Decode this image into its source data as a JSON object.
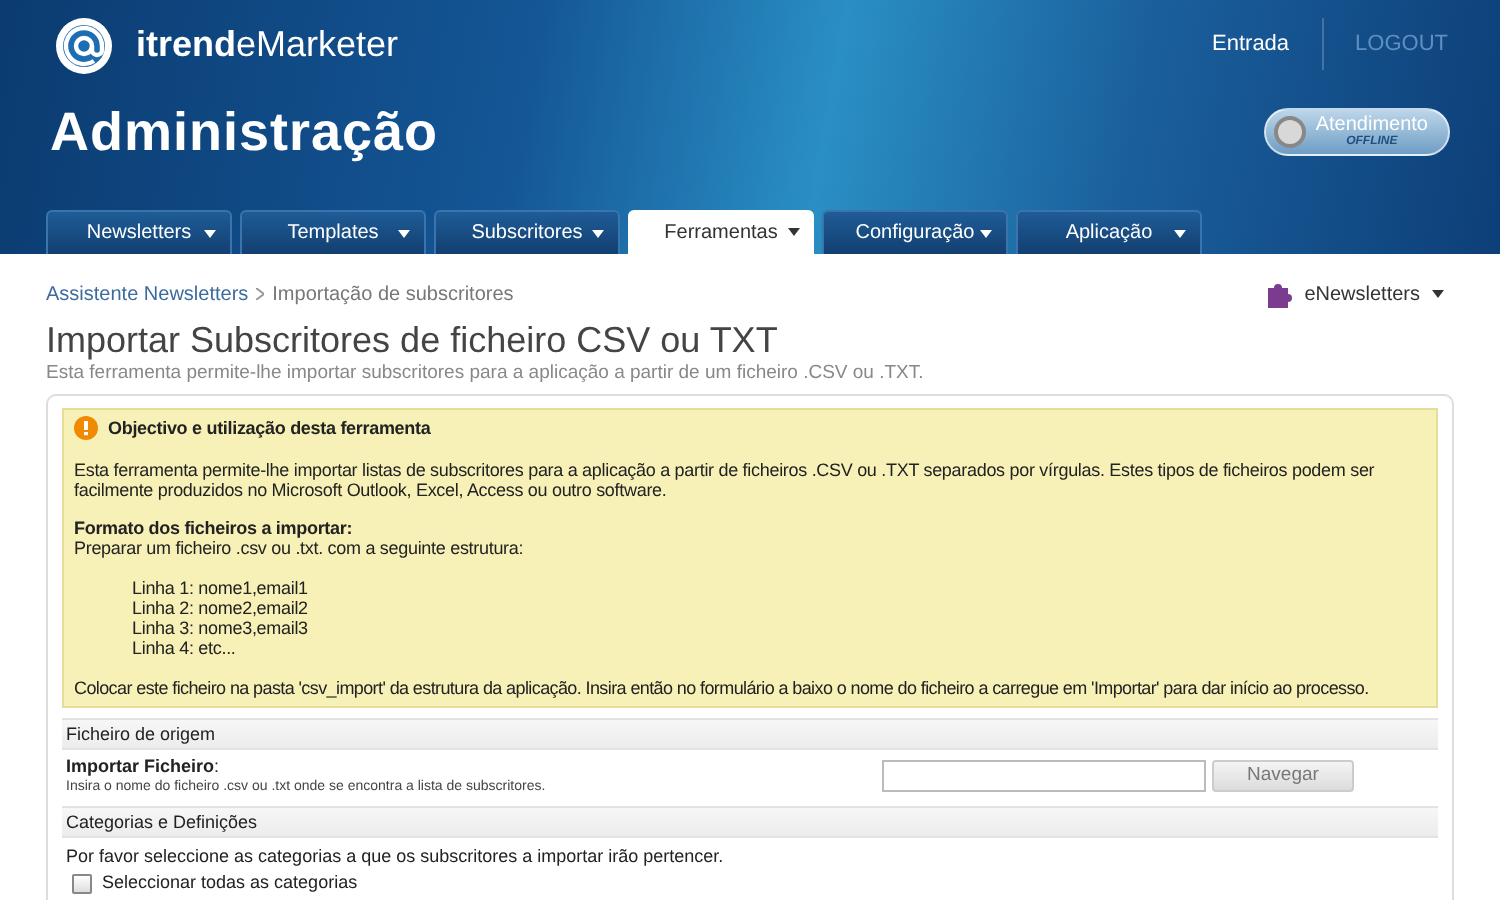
{
  "header": {
    "brand": {
      "bold": "itrend",
      "rest": "eMarketer"
    },
    "links": [
      {
        "label": "Entrada",
        "muted": false
      },
      {
        "label": "LOGOUT",
        "muted": true
      }
    ],
    "title": "Administração",
    "chat": {
      "label": "Atendimento",
      "status": "OFFLINE"
    }
  },
  "tabs": [
    {
      "label": "Newsletters",
      "selected": false
    },
    {
      "label": "Templates",
      "selected": false
    },
    {
      "label": "Subscritores",
      "selected": false
    },
    {
      "label": "Ferramentas",
      "selected": true
    },
    {
      "label": "Configuração",
      "selected": false
    },
    {
      "label": "Aplicação",
      "selected": false
    }
  ],
  "breadcrumb": [
    "Assistente Newsletters",
    "Importação de subscritores"
  ],
  "module_menu": {
    "label": "eNewsletters"
  },
  "page": {
    "title": "Importar Subscritores de ficheiro CSV ou TXT",
    "subtitle": "Esta ferramenta permite-lhe importar subscritores para a aplicação a partir de um ficheiro .CSV ou .TXT."
  },
  "notice": {
    "title": "Objectivo e utilização desta ferramenta",
    "text": "Esta ferramenta permite-lhe importar listas de subscritores para a aplicação a partir de ficheiros .CSV ou .TXT separados por vírgulas. Estes tipos de ficheiros podem ser facilmente produzidos no Microsoft Outlook, Excel, Access ou outro software.",
    "format_title": "Formato dos ficheiros a importar:",
    "format_intro": "Preparar um ficheiro .csv ou .txt. com a seguinte estrutura:",
    "lines": [
      "Linha 1: nome1,email1",
      "Linha 2: nome2,email2",
      "Linha 3: nome3,email3",
      "Linha 4: etc..."
    ],
    "footer": "Colocar este ficheiro na pasta 'csv_import' da estrutura da aplicação. Insira então no formulário a baixo o nome do ficheiro a carregue em 'Importar' para dar início ao processo."
  },
  "sections": [
    {
      "title": "Ficheiro de origem",
      "field": {
        "label": "**Importar Ficheiro**:",
        "hint": "Insira o nome do ficheiro .csv ou .txt onde se encontra a lista de subscritores.",
        "button": "Navegar"
      }
    },
    {
      "title": "Categorias e Definições",
      "text": "Por favor seleccione as categorias a que os subscritores a importar irão pertencer.",
      "checkbox": {
        "label": "Seleccionar todas as categorias",
        "checked": false
      }
    }
  ]
}
